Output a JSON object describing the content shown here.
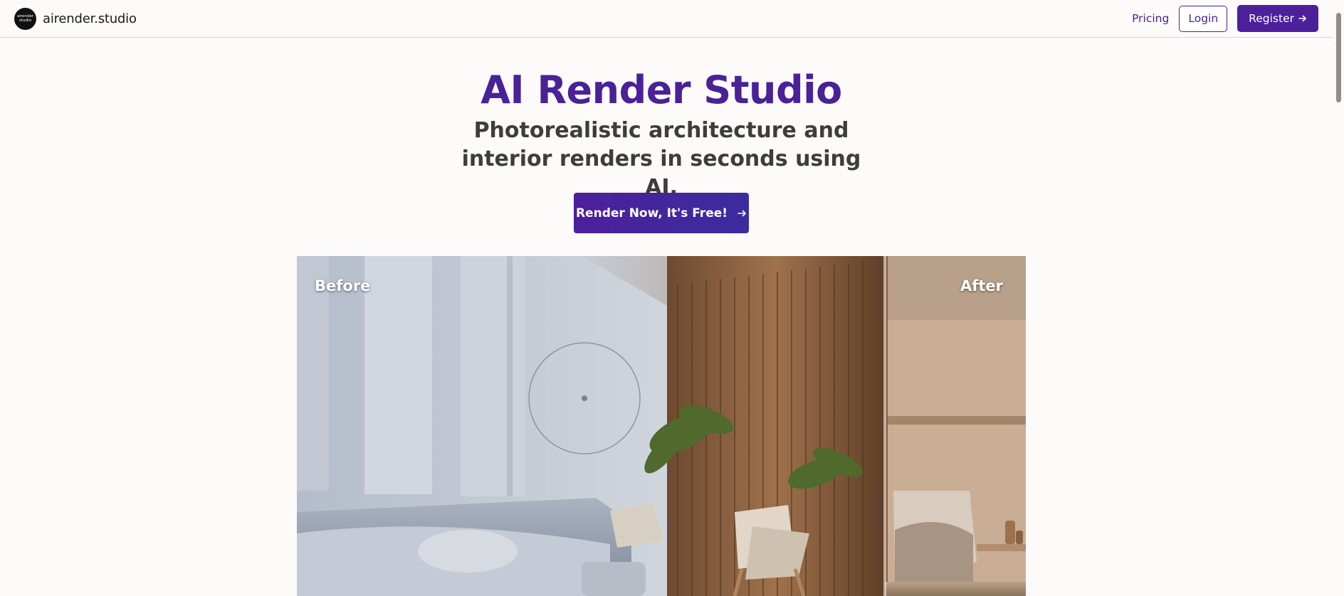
{
  "header": {
    "logo_line1": "airender",
    "logo_line2": "studio",
    "brand_name": "airender.studio",
    "pricing_label": "Pricing",
    "login_label": "Login",
    "register_label": "Register",
    "register_icon": "arrow-right-icon"
  },
  "hero": {
    "title": "AI Render Studio",
    "subtitle": "Photorealistic architecture and interior renders in seconds using AI.",
    "cta_label": "Render Now, It's Free!",
    "cta_icon": "arrow-right-icon"
  },
  "compare": {
    "before_label": "Before",
    "after_label": "After"
  },
  "colors": {
    "brand": "#4a2196",
    "background": "#fcfbfa",
    "subtitle": "#3d3d3d"
  }
}
